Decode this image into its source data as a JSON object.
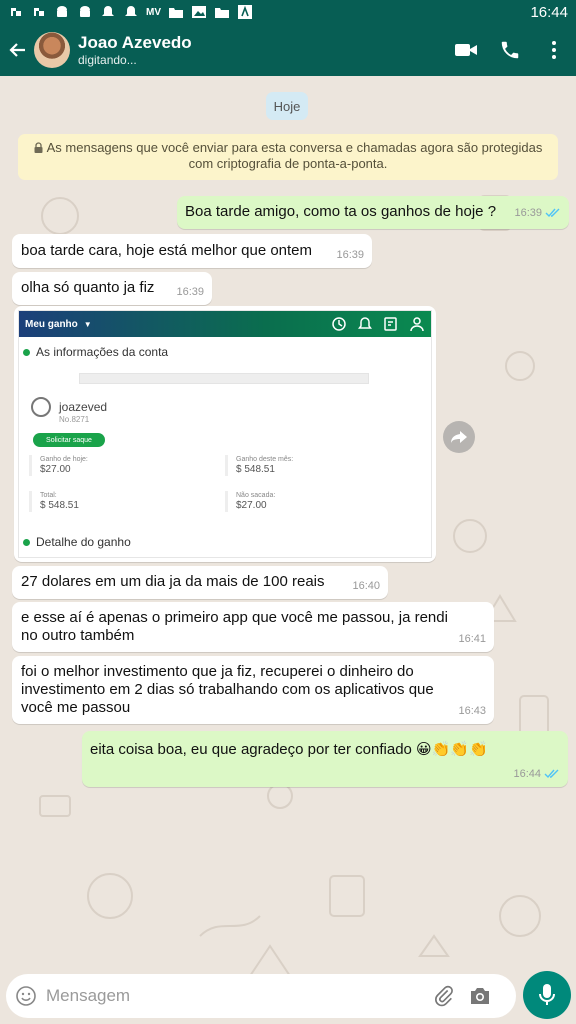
{
  "status_bar": {
    "time": "16:44",
    "carrier": "MV"
  },
  "header": {
    "contact_name": "Joao Azevedo",
    "status": "digitando..."
  },
  "chat": {
    "date_chip": "Hoje",
    "encryption_notice": "As mensagens que você enviar para esta conversa e chamadas agora são protegidas com criptografia de ponta-a-ponta.",
    "messages": [
      {
        "direction": "out",
        "text": "Boa tarde amigo, como ta os ganhos de hoje ?",
        "time": "16:39"
      },
      {
        "direction": "in",
        "text": "boa tarde cara, hoje está melhor que ontem",
        "time": "16:39"
      },
      {
        "direction": "in",
        "text": "olha só quanto ja fiz",
        "time": "16:39"
      },
      {
        "direction": "in",
        "text": "27 dolares em um dia ja da mais de 100 reais",
        "time": "16:40"
      },
      {
        "direction": "in",
        "text": "e esse aí é apenas o primeiro app que você me passou, ja rendi no outro também",
        "time": "16:41"
      },
      {
        "direction": "in",
        "text": "foi o melhor investimento que ja fiz, recuperei o dinheiro do investimento em 2 dias só trabalhando com os aplicativos que você me passou",
        "time": "16:43"
      },
      {
        "direction": "out",
        "text": "eita coisa boa, eu que agradeço por ter confiado 😀👏👏👏",
        "time": "16:44"
      }
    ],
    "image_message": {
      "app_title": "Meu ganho",
      "section_account": "As informações da conta",
      "username": "joazeved",
      "user_no": "No.8271",
      "withdraw_button": "Solicitar saque",
      "stats": [
        {
          "label": "Ganho de hoje:",
          "value": "$27.00"
        },
        {
          "label": "Ganho deste mês:",
          "value": "$ 548.51"
        },
        {
          "label": "Total:",
          "value": "$ 548.51"
        },
        {
          "label": "Não sacada:",
          "value": "$27.00"
        }
      ],
      "section_details": "Detalhe do ganho"
    }
  },
  "input": {
    "placeholder": "Mensagem"
  },
  "colors": {
    "header": "#075e54",
    "outgoing_bubble": "#dcf8c6",
    "incoming_bubble": "#ffffff",
    "mic_button": "#00897b",
    "read_ticks": "#4fc3f7"
  }
}
